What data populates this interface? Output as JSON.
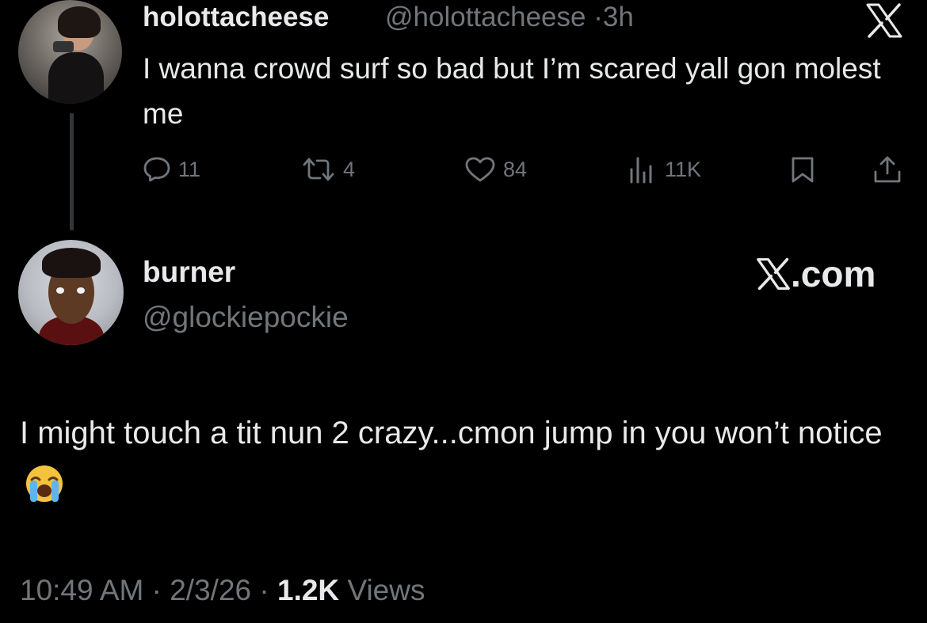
{
  "tweet_1": {
    "display_name": "holottacheese",
    "handle": "@holottacheese",
    "separator": "·",
    "time_ago": "3h",
    "text": "I wanna crowd surf so bad but I’m scared yall gon molest me",
    "actions": {
      "replies": "11",
      "reposts": "4",
      "likes": "84",
      "views": "11K"
    },
    "icons": [
      "x-logo-icon",
      "reply-icon",
      "repost-icon",
      "like-icon",
      "views-icon",
      "bookmark-icon",
      "share-icon"
    ]
  },
  "tweet_2": {
    "display_name": "burner",
    "handle": "@glockiepockie",
    "brand": ".com",
    "text": "I might touch a tit nun 2 crazy...cmon jump in you won’t notice",
    "emoji": "loudly-crying-face-icon",
    "footer": {
      "time": "10:49 AM",
      "sep1": "·",
      "date": "2/3/26",
      "sep2": "·",
      "views_count": "1.2K",
      "views_label": "Views"
    }
  },
  "colors": {
    "background": "#000000",
    "primary_text": "#e7e9ea",
    "secondary_text": "#71767b",
    "thread_line": "#333639"
  }
}
